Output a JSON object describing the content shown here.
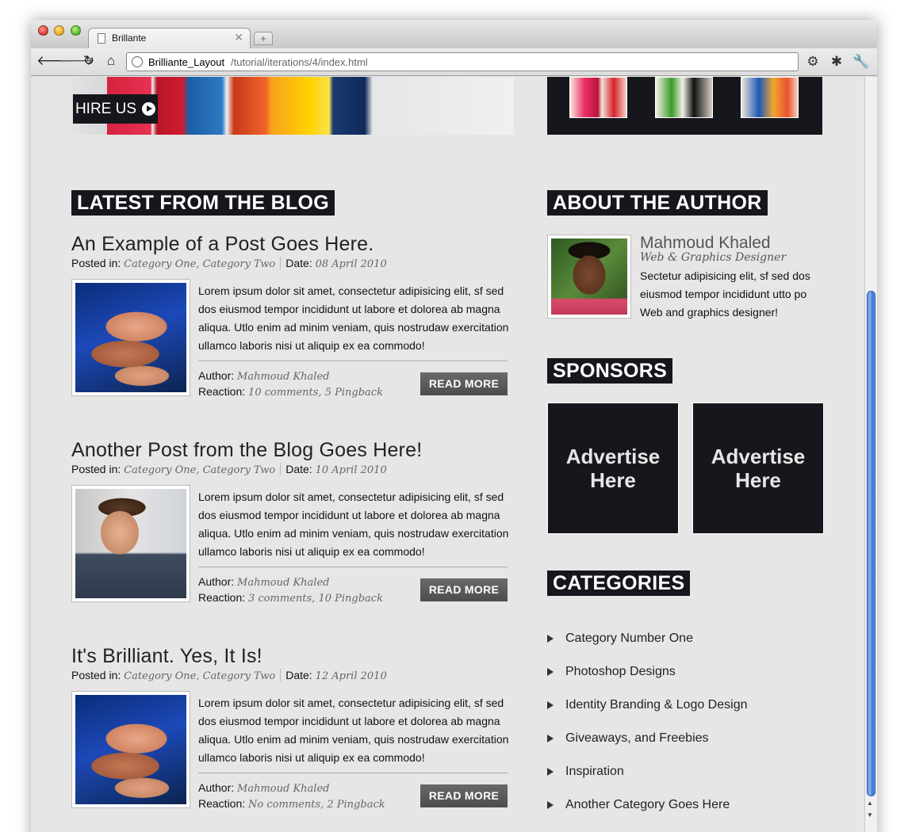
{
  "browser": {
    "tab_title": "Brillante",
    "url_host": "Brilliante_Layout",
    "url_path": "/tutorial/iterations/4/index.html"
  },
  "hero": {
    "hire_us_label": "HIRE US"
  },
  "blog": {
    "heading": "LATEST FROM THE BLOG",
    "posts": [
      {
        "title": "An Example of a Post Goes Here.",
        "posted_label": "Posted in: ",
        "categories": "Category One, Category Two",
        "date_label": "Date: ",
        "date": "08 April 2010",
        "excerpt": "Lorem ipsum dolor sit amet, consectetur adipisicing elit, sf sed dos eiusmod tempor incididunt ut labore et dolorea ab magna aliqua. Utlo enim ad minim veniam, quis nostrudaw exercitation ullamco laboris nisi ut aliquip ex ea commodo!",
        "author_label": "Author: ",
        "author": "Mahmoud Khaled",
        "reaction_label": "Reaction: ",
        "reaction": "10 comments, 5 Pingback",
        "read_more": "READ MORE",
        "image": "hands-photo"
      },
      {
        "title": "Another Post from the Blog Goes Here!",
        "posted_label": "Posted in: ",
        "categories": "Category One, Category Two",
        "date_label": "Date: ",
        "date": "10 April 2010",
        "excerpt": "Lorem ipsum dolor sit amet, consectetur adipisicing elit, sf sed dos eiusmod tempor incididunt ut labore et dolorea ab magna aliqua. Utlo enim ad minim veniam, quis nostrudaw exercitation ullamco laboris nisi ut aliquip ex ea commodo!",
        "author_label": "Author: ",
        "author": "Mahmoud Khaled",
        "reaction_label": "Reaction: ",
        "reaction": "3 comments, 10 Pingback",
        "read_more": "READ MORE",
        "image": "phone-man-photo"
      },
      {
        "title": "It's Brilliant. Yes, It Is!",
        "posted_label": "Posted in: ",
        "categories": "Category One, Category Two",
        "date_label": "Date: ",
        "date": "12 April 2010",
        "excerpt": "Lorem ipsum dolor sit amet, consectetur adipisicing elit, sf sed dos eiusmod tempor incididunt ut labore et dolorea ab magna aliqua. Utlo enim ad minim veniam, quis nostrudaw exercitation ullamco laboris nisi ut aliquip ex ea commodo!",
        "author_label": "Author: ",
        "author": "Mahmoud Khaled",
        "reaction_label": "Reaction: ",
        "reaction": "No comments, 2 Pingback",
        "read_more": "READ MORE",
        "image": "hands-photo"
      }
    ]
  },
  "about": {
    "heading": "ABOUT THE AUTHOR",
    "name": "Mahmoud Khaled",
    "role": "Web & Graphics Designer",
    "bio": "Sectetur adipisicing elit, sf sed dos eiusmod tempor incididunt utto po Web and graphics designer!"
  },
  "sponsors": {
    "heading": "SPONSORS",
    "ads": [
      "Advertise Here",
      "Advertise Here"
    ]
  },
  "categories": {
    "heading": "CATEGORIES",
    "items": [
      "Category Number One",
      "Photoshop Designs",
      "Identity Branding & Logo Design",
      "Giveaways, and Freebies",
      "Inspiration",
      "Another Category Goes Here"
    ]
  },
  "colors": {
    "dark_block": "#15171c",
    "page_bg": "#e6e6e6",
    "read_more_bg": "#5a5a5a",
    "scrollbar_blue": "#5b8ee0"
  },
  "icons": [
    "close-window-icon",
    "minimize-window-icon",
    "maximize-window-icon",
    "document-icon",
    "globe-icon",
    "back-arrow-icon",
    "forward-arrow-icon",
    "reload-icon",
    "home-icon",
    "page-menu-icon",
    "extension-icon",
    "wrench-icon",
    "play-circle-icon",
    "triangle-bullet-icon"
  ]
}
